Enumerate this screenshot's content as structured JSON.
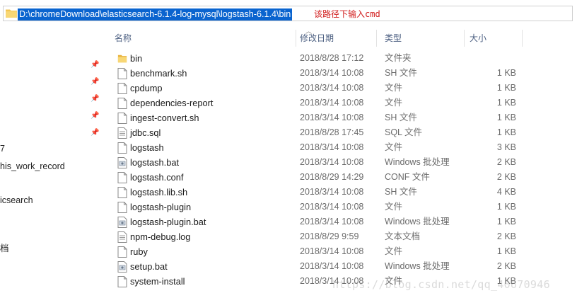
{
  "address_bar": {
    "path": "D:\\chromeDownload\\elasticsearch-6.1.4-log-mysql\\logstash-6.1.4\\bin",
    "annotation": "该路径下输入cmd"
  },
  "sidebar": {
    "items": [
      {
        "label": "7"
      },
      {
        "label": "his_work_record"
      },
      {
        "label": "icsearch"
      },
      {
        "label": "档"
      }
    ]
  },
  "columns": {
    "name": "名称",
    "date": "修改日期",
    "type": "类型",
    "size": "大小"
  },
  "files": [
    {
      "name": "bin",
      "date": "2018/8/28 17:12",
      "type": "文件夹",
      "size": "",
      "icon": "folder-icon"
    },
    {
      "name": "benchmark.sh",
      "date": "2018/3/14 10:08",
      "type": "SH 文件",
      "size": "1 KB",
      "icon": "file-icon"
    },
    {
      "name": "cpdump",
      "date": "2018/3/14 10:08",
      "type": "文件",
      "size": "1 KB",
      "icon": "file-icon"
    },
    {
      "name": "dependencies-report",
      "date": "2018/3/14 10:08",
      "type": "文件",
      "size": "1 KB",
      "icon": "file-icon"
    },
    {
      "name": "ingest-convert.sh",
      "date": "2018/3/14 10:08",
      "type": "SH 文件",
      "size": "1 KB",
      "icon": "file-icon"
    },
    {
      "name": "jdbc.sql",
      "date": "2018/8/28 17:45",
      "type": "SQL 文件",
      "size": "1 KB",
      "icon": "text-file-icon"
    },
    {
      "name": "logstash",
      "date": "2018/3/14 10:08",
      "type": "文件",
      "size": "3 KB",
      "icon": "file-icon"
    },
    {
      "name": "logstash.bat",
      "date": "2018/3/14 10:08",
      "type": "Windows 批处理",
      "size": "2 KB",
      "icon": "batch-file-icon"
    },
    {
      "name": "logstash.conf",
      "date": "2018/8/29 14:29",
      "type": "CONF 文件",
      "size": "2 KB",
      "icon": "file-icon"
    },
    {
      "name": "logstash.lib.sh",
      "date": "2018/3/14 10:08",
      "type": "SH 文件",
      "size": "4 KB",
      "icon": "file-icon"
    },
    {
      "name": "logstash-plugin",
      "date": "2018/3/14 10:08",
      "type": "文件",
      "size": "1 KB",
      "icon": "file-icon"
    },
    {
      "name": "logstash-plugin.bat",
      "date": "2018/3/14 10:08",
      "type": "Windows 批处理",
      "size": "1 KB",
      "icon": "batch-file-icon"
    },
    {
      "name": "npm-debug.log",
      "date": "2018/8/29 9:59",
      "type": "文本文档",
      "size": "2 KB",
      "icon": "text-file-icon"
    },
    {
      "name": "ruby",
      "date": "2018/3/14 10:08",
      "type": "文件",
      "size": "1 KB",
      "icon": "file-icon"
    },
    {
      "name": "setup.bat",
      "date": "2018/3/14 10:08",
      "type": "Windows 批处理",
      "size": "2 KB",
      "icon": "batch-file-icon"
    },
    {
      "name": "system-install",
      "date": "2018/3/14 10:08",
      "type": "文件",
      "size": "1 KB",
      "icon": "file-icon"
    }
  ],
  "watermark": "https://blog.csdn.net/qq_40670946",
  "colors": {
    "selection": "#0a64cf",
    "annotation": "#d11b1b",
    "folder": "#f3c552",
    "header_text": "#4d6082"
  }
}
